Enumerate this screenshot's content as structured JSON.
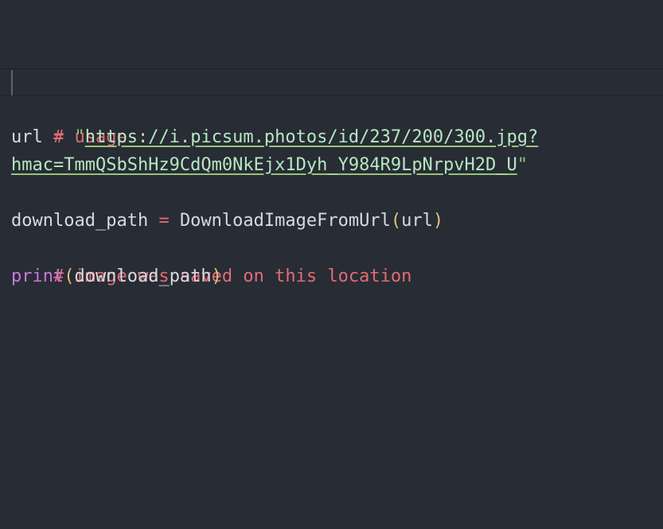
{
  "editor": {
    "lines": {
      "comment_usage": "# usage",
      "url_var": "url",
      "assign_op": "=",
      "quote_open": "\"",
      "url_part1": "https://i.picsum.photos/id/237/200/300.jpg?",
      "url_part2": "hmac=TmmQSbShHz9CdQm0NkEjx1Dyh_Y984R9LpNrpvH2D_U",
      "quote_close": "\"",
      "dl_var": "download_path",
      "func_name": "DownloadImageFromUrl",
      "paren_open": "(",
      "arg": "url",
      "paren_close": ")",
      "comment_saved": "# image was saved on this location",
      "print_fn": "print",
      "print_arg": "download_path"
    }
  },
  "colors": {
    "background": "#282c34",
    "comment": "#e06c75",
    "string": "#98c379",
    "keyword_builtin": "#c678dd",
    "bracket": "#e5c07b"
  }
}
